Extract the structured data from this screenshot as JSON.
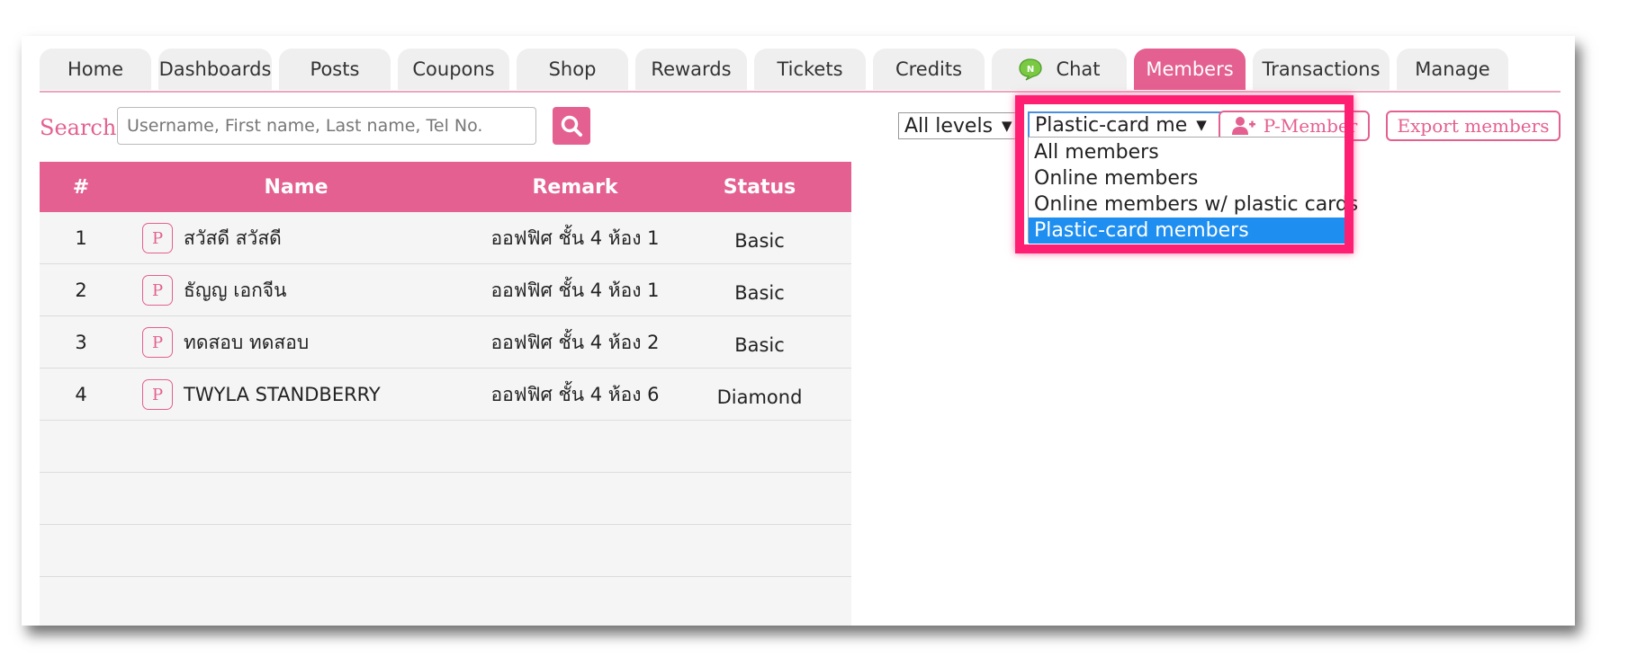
{
  "tabs": [
    {
      "label": "Home"
    },
    {
      "label": "Dashboards"
    },
    {
      "label": "Posts"
    },
    {
      "label": "Coupons"
    },
    {
      "label": "Shop"
    },
    {
      "label": "Rewards"
    },
    {
      "label": "Tickets"
    },
    {
      "label": "Credits"
    },
    {
      "label": "Chat",
      "icon": "chat-icon"
    },
    {
      "label": "Members",
      "active": true
    },
    {
      "label": "Transactions"
    },
    {
      "label": "Manage"
    }
  ],
  "search": {
    "label": "Search",
    "placeholder": "Username, First name, Last name, Tel No.",
    "value": ""
  },
  "filters": {
    "levels_selected": "All levels",
    "type_selected": "Plastic-card me",
    "type_options": [
      {
        "label": "All members"
      },
      {
        "label": "Online members"
      },
      {
        "label": "Online members w/ plastic cards"
      },
      {
        "label": "Plastic-card members",
        "selected": true
      }
    ]
  },
  "buttons": {
    "p_member": "P-Member",
    "export": "Export members"
  },
  "table": {
    "headers": {
      "num": "#",
      "name": "Name",
      "remark": "Remark",
      "status": "Status"
    },
    "badge": "P",
    "rows": [
      {
        "num": "1",
        "name": "สวัสดี สวัสดี",
        "remark": "ออฟฟิศ ชั้น 4 ห้อง 1",
        "status": "Basic"
      },
      {
        "num": "2",
        "name": "ธัญญ เอกจีน",
        "remark": "ออฟฟิศ ชั้น 4 ห้อง 1",
        "status": "Basic"
      },
      {
        "num": "3",
        "name": "ทดสอบ ทดสอบ",
        "remark": "ออฟฟิศ ชั้น 4 ห้อง 2",
        "status": "Basic"
      },
      {
        "num": "4",
        "name": "TWYLA STANDBERRY",
        "remark": "ออฟฟิศ ชั้น 4 ห้อง 6",
        "status": "Diamond"
      }
    ]
  },
  "colors": {
    "accent": "#e46090",
    "highlight": "#ff1f72",
    "option_selected": "#1e8ef0"
  }
}
